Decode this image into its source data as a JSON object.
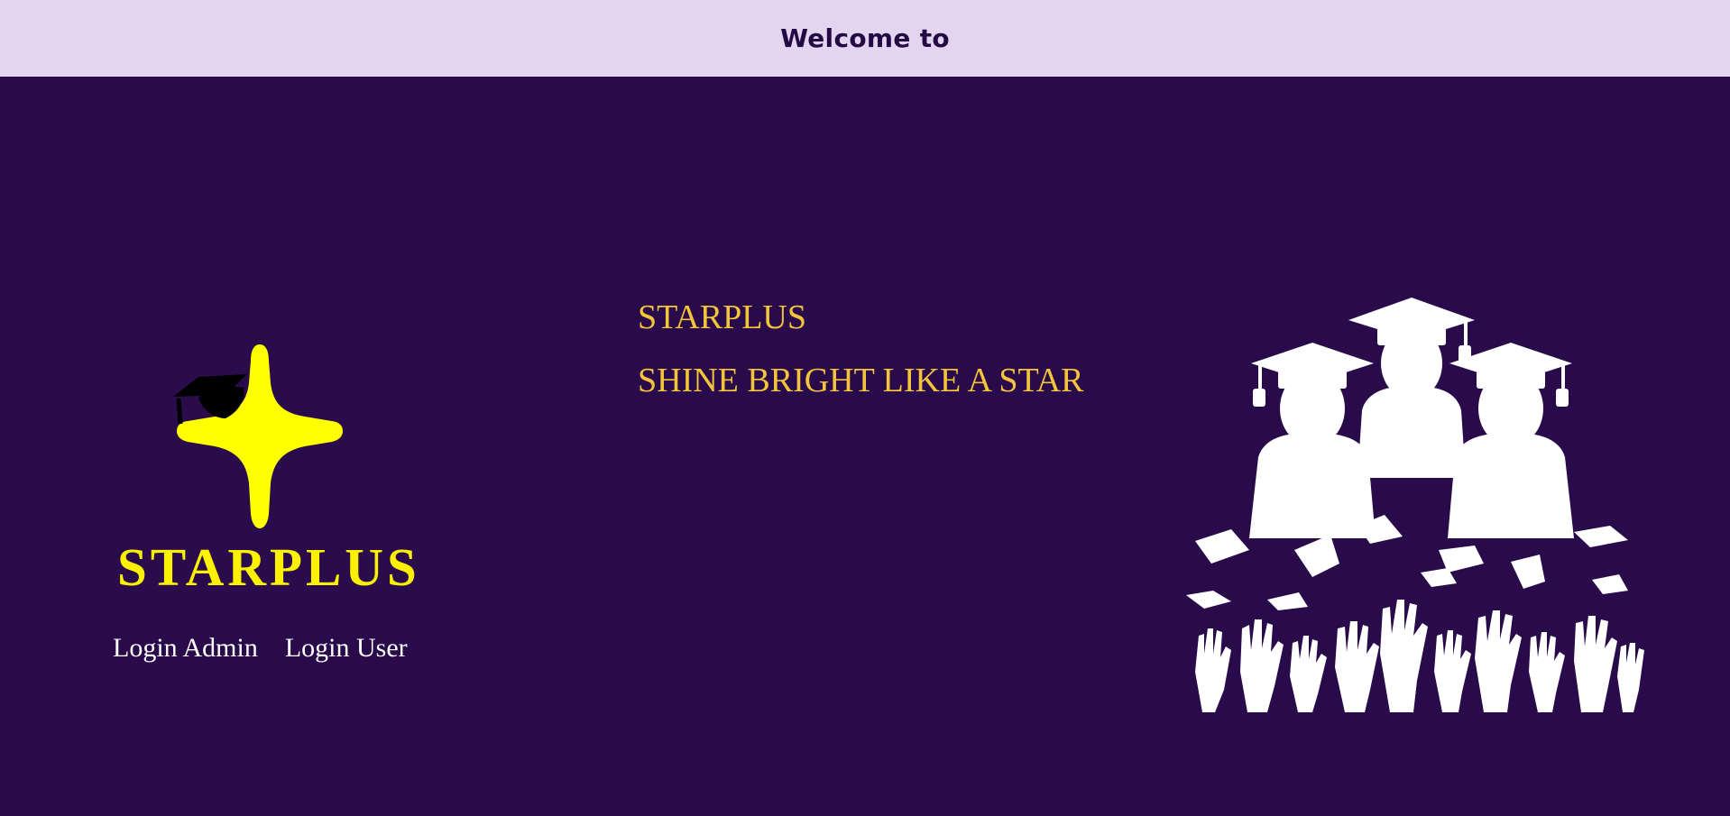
{
  "header": {
    "title": "Welcome to"
  },
  "logo": {
    "wordmark": "STARPLUS"
  },
  "auth": {
    "admin_label": "Login Admin",
    "user_label": "Login User"
  },
  "hero": {
    "brand": "STARPLUS",
    "tagline": "SHINE BRIGHT LIKE A STAR"
  },
  "illustration": {
    "icon": "graduates-celebration-icon"
  },
  "colors": {
    "background": "#290a4a",
    "header_bg": "#e3d5ef",
    "header_text": "#240a44",
    "accent_gold": "#f4c43a",
    "logo_yellow": "#fbf100",
    "link_text": "#ffffff"
  }
}
